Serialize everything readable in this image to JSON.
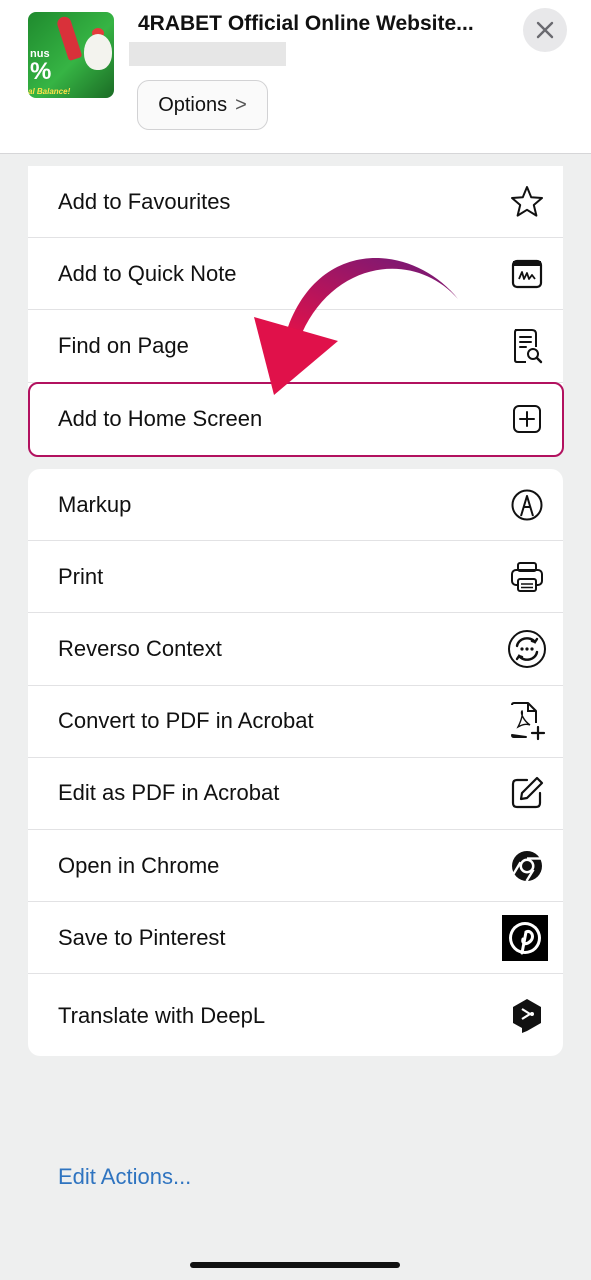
{
  "header": {
    "site_title": "4RABET Official Online Website...",
    "options_label": "Options",
    "options_chevron": ">",
    "thumb_text": [
      "nus",
      "%",
      "al Balance!"
    ]
  },
  "actions_group1": [
    {
      "label": "Add to Favourites",
      "icon": "star-icon"
    },
    {
      "label": "Add to Quick Note",
      "icon": "quick-note-icon"
    },
    {
      "label": "Find on Page",
      "icon": "find-on-page-icon"
    },
    {
      "label": "Add to Home Screen",
      "icon": "add-square-icon"
    }
  ],
  "actions_group2": [
    {
      "label": "Markup",
      "icon": "markup-pen-icon"
    },
    {
      "label": "Print",
      "icon": "printer-icon"
    },
    {
      "label": "Reverso Context",
      "icon": "reverso-icon"
    },
    {
      "label": "Convert to PDF in Acrobat",
      "icon": "acrobat-convert-icon"
    },
    {
      "label": "Edit as PDF in Acrobat",
      "icon": "edit-pencil-icon"
    },
    {
      "label": "Open in Chrome",
      "icon": "chrome-icon"
    },
    {
      "label": "Save to Pinterest",
      "icon": "pinterest-icon"
    },
    {
      "label": "Translate with DeepL",
      "icon": "deepl-icon"
    }
  ],
  "edit_actions_label": "Edit Actions...",
  "colors": {
    "highlight_border": "#b2115f",
    "arrow_start": "#6b1a7a",
    "arrow_end": "#e0114a",
    "link_blue": "#2f74c0",
    "background": "#eeefef"
  }
}
